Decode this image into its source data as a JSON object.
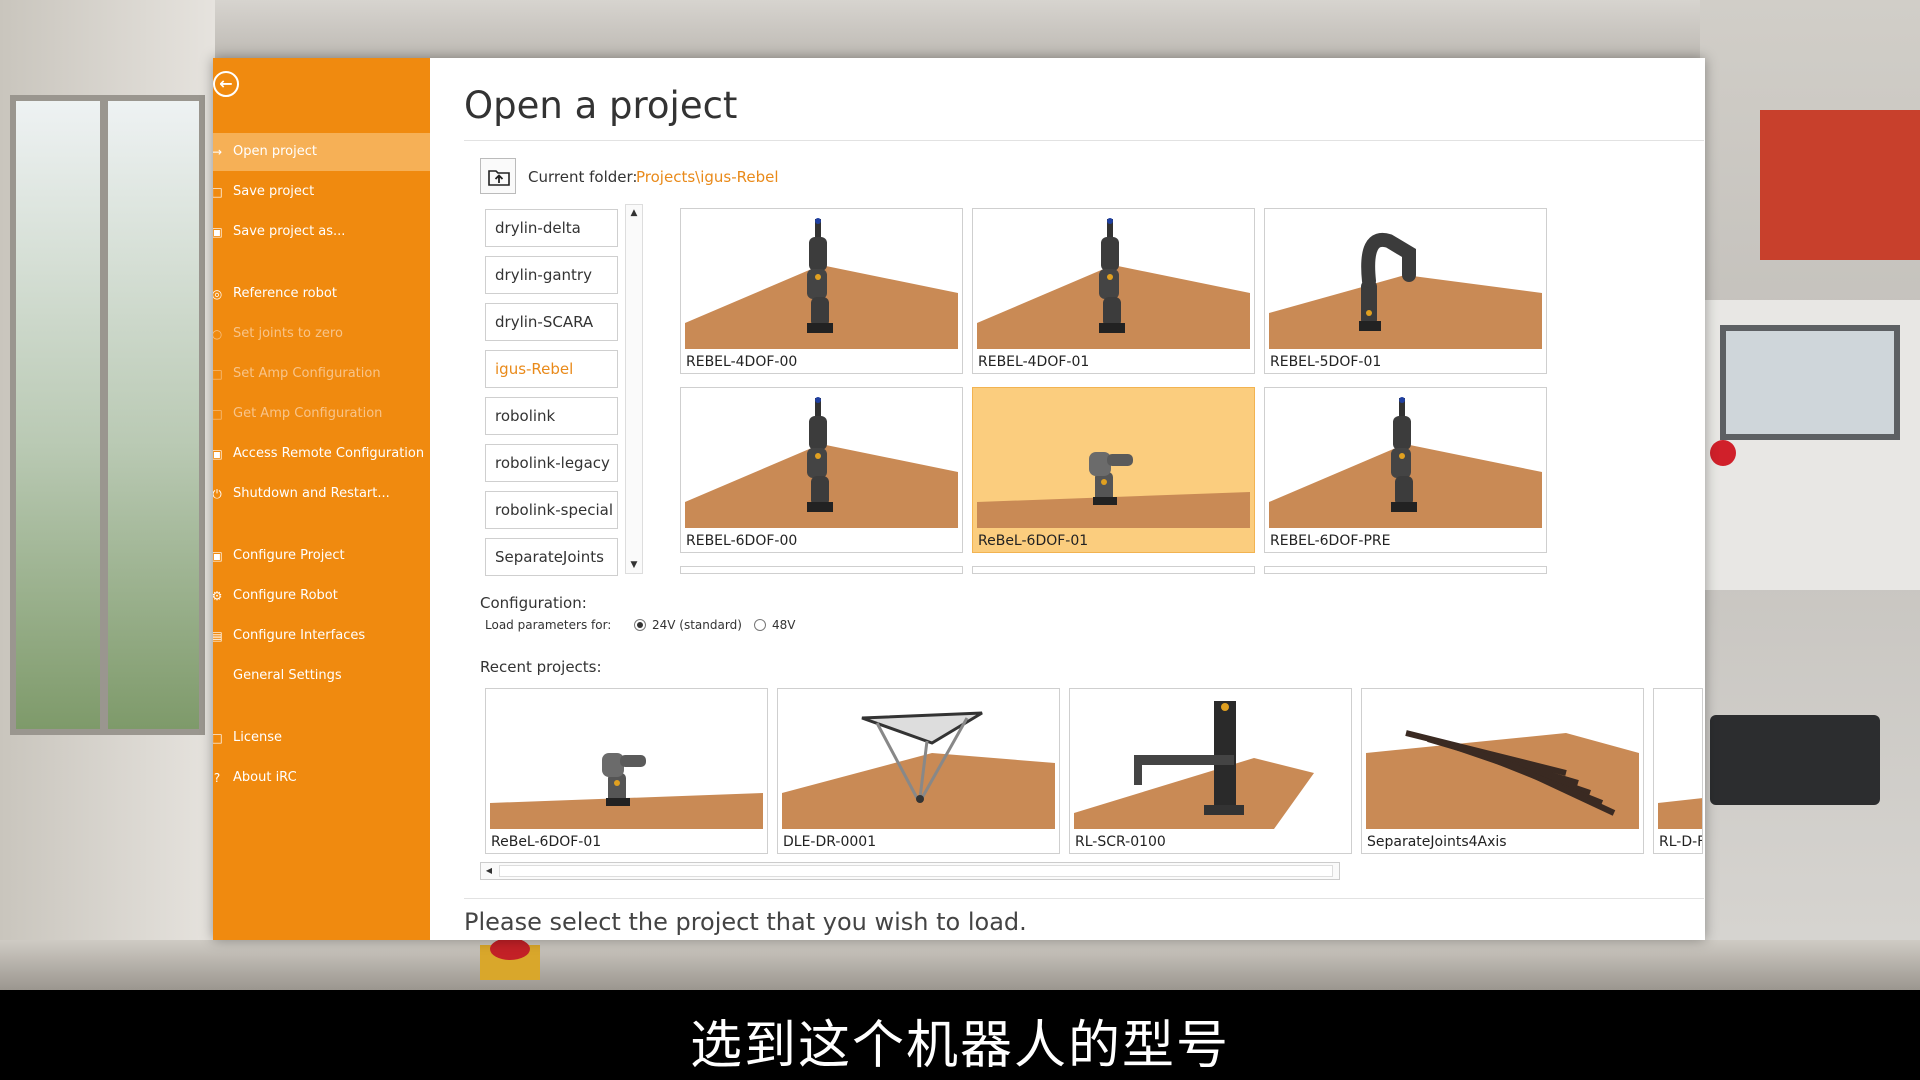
{
  "subtitle": "选到这个机器人的型号",
  "sidebar": {
    "items": [
      {
        "label": "Open project",
        "icon": "arrow-right-icon",
        "state": "active"
      },
      {
        "label": "Save project",
        "icon": "save-icon",
        "state": "normal"
      },
      {
        "label": "Save project as...",
        "icon": "save-as-icon",
        "state": "normal"
      },
      {
        "label": "Reference robot",
        "icon": "reference-icon",
        "state": "normal"
      },
      {
        "label": "Set joints to zero",
        "icon": "zero-icon",
        "state": "disabled"
      },
      {
        "label": "Set Amp Configuration",
        "icon": "amp-set-icon",
        "state": "disabled"
      },
      {
        "label": "Get Amp Configuration",
        "icon": "amp-get-icon",
        "state": "disabled"
      },
      {
        "label": "Access Remote Configuration",
        "icon": "remote-icon",
        "state": "normal"
      },
      {
        "label": "Shutdown and Restart...",
        "icon": "power-icon",
        "state": "normal"
      },
      {
        "label": "Configure Project",
        "icon": "project-icon",
        "state": "normal"
      },
      {
        "label": "Configure Robot",
        "icon": "gear-icon",
        "state": "normal"
      },
      {
        "label": "Configure Interfaces",
        "icon": "interfaces-icon",
        "state": "normal"
      },
      {
        "label": "General Settings",
        "icon": "",
        "state": "normal"
      },
      {
        "label": "License",
        "icon": "license-icon",
        "state": "normal"
      },
      {
        "label": "About iRC",
        "icon": "help-icon",
        "state": "normal"
      }
    ]
  },
  "main": {
    "title": "Open a project",
    "current_folder_label": "Current folder:",
    "current_folder_path": "Projects\\igus-Rebel",
    "folders": [
      {
        "label": "drylin-delta",
        "selected": false
      },
      {
        "label": "drylin-gantry",
        "selected": false
      },
      {
        "label": "drylin-SCARA",
        "selected": false
      },
      {
        "label": "igus-Rebel",
        "selected": true
      },
      {
        "label": "robolink",
        "selected": false
      },
      {
        "label": "robolink-legacy",
        "selected": false
      },
      {
        "label": "robolink-special",
        "selected": false
      },
      {
        "label": "SeparateJoints",
        "selected": false
      }
    ],
    "projects": [
      {
        "label": "REBEL-4DOF-00",
        "model": "tall-arm",
        "selected": false
      },
      {
        "label": "REBEL-4DOF-01",
        "model": "tall-arm",
        "selected": false
      },
      {
        "label": "REBEL-5DOF-01",
        "model": "bent-arm",
        "selected": false
      },
      {
        "label": "REBEL-6DOF-00",
        "model": "tall-arm",
        "selected": false
      },
      {
        "label": "ReBeL-6DOF-01",
        "model": "small-arm",
        "selected": true
      },
      {
        "label": "REBEL-6DOF-PRE",
        "model": "tall-arm",
        "selected": false
      }
    ],
    "configuration_label": "Configuration:",
    "load_parameters_label": "Load parameters for:",
    "voltage_options": [
      {
        "label": "24V (standard)",
        "checked": true
      },
      {
        "label": "48V",
        "checked": false
      }
    ],
    "recent_label": "Recent projects:",
    "recent_projects": [
      {
        "label": "ReBeL-6DOF-01",
        "model": "small-arm"
      },
      {
        "label": "DLE-DR-0001",
        "model": "delta"
      },
      {
        "label": "RL-SCR-0100",
        "model": "scara"
      },
      {
        "label": "SeparateJoints4Axis",
        "model": "rails"
      },
      {
        "label": "RL-D-F",
        "model": "partial"
      }
    ],
    "status": "Please select the project that you wish to load."
  },
  "colors": {
    "accent": "#f08a0f",
    "selected_tile": "#fbcd7e",
    "floor": "#c98a55",
    "folder_path": "#e98a1a"
  }
}
